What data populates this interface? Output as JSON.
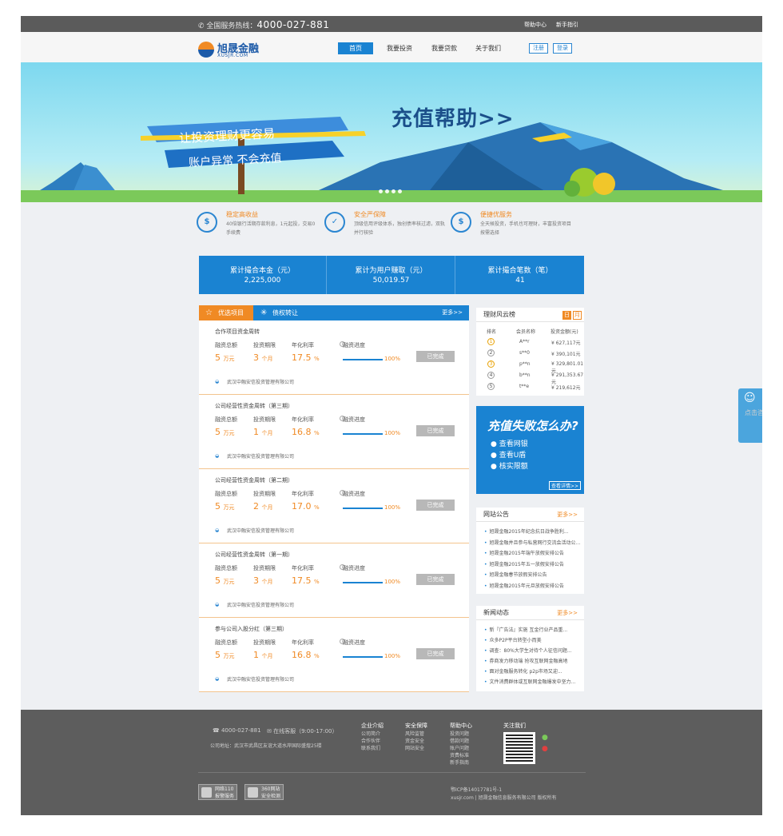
{
  "topbar": {
    "hotline_label": "全国服务热线：",
    "hotline_number": "4000-027-881",
    "help": "帮助中心",
    "guide": "新手指引"
  },
  "header": {
    "logo_name": "旭晟金融",
    "logo_url": "XUSJR.COM",
    "nav": [
      "首页",
      "我要投资",
      "我要贷款",
      "关于我们"
    ],
    "register": "注册",
    "login": "登录"
  },
  "banner": {
    "title": "充值帮助>>",
    "sign1": "让投资理财更容易",
    "sign2": "账户异常  不会充值"
  },
  "features": [
    {
      "title": "稳定高收益",
      "desc": "40倍银行活期存款利息，1元起投，交易0手续费"
    },
    {
      "title": "安全严保障",
      "desc": "顶级信用评级体系，独创债率核过滤，双轨并行核验"
    },
    {
      "title": "便捷优服务",
      "desc": "全天候投资，手机也可理财，丰富投资项目按需选择"
    }
  ],
  "stats": [
    {
      "label": "累计撮合本金（元）",
      "value": "2,225,000"
    },
    {
      "label": "累计为用户赚取（元）",
      "value": "50,019.57"
    },
    {
      "label": "累计撮合笔数（笔）",
      "value": "41"
    }
  ],
  "projects_panel": {
    "tab1": "优选项目",
    "tab2": "债权转让",
    "more": "更多>>"
  },
  "project_labels": {
    "total": "融资总额",
    "period": "投资期限",
    "rate": "年化利率",
    "progress": "融资进度",
    "done": "已完成"
  },
  "projects": [
    {
      "title": "合作项目资金周转",
      "total": "5",
      "total_unit": "万元",
      "period": "3",
      "period_unit": "个月",
      "rate": "17.5",
      "rate_unit": "%",
      "progress": "100%",
      "company": "武汉中融安信投资管理有限公司"
    },
    {
      "title": "公司经营性资金周转（第三期）",
      "total": "5",
      "total_unit": "万元",
      "period": "1",
      "period_unit": "个月",
      "rate": "16.8",
      "rate_unit": "%",
      "progress": "100%",
      "company": "武汉中融安信投资管理有限公司"
    },
    {
      "title": "公司经营性资金周转（第二期）",
      "total": "5",
      "total_unit": "万元",
      "period": "2",
      "period_unit": "个月",
      "rate": "17.0",
      "rate_unit": "%",
      "progress": "100%",
      "company": "武汉中融安信投资管理有限公司"
    },
    {
      "title": "公司经营性资金周转（第一期）",
      "total": "5",
      "total_unit": "万元",
      "period": "3",
      "period_unit": "个月",
      "rate": "17.5",
      "rate_unit": "%",
      "progress": "100%",
      "company": "武汉中融安信投资管理有限公司"
    },
    {
      "title": "参与公司入股分红（第三期）",
      "total": "5",
      "total_unit": "万元",
      "period": "1",
      "period_unit": "个月",
      "rate": "16.8",
      "rate_unit": "%",
      "progress": "100%",
      "company": "武汉中融安信投资管理有限公司"
    }
  ],
  "ranking": {
    "title": "理财风云榜",
    "tab_day": "日",
    "tab_month": "月",
    "headers": [
      "排名",
      "会员名称",
      "投资金额(元)"
    ],
    "rows": [
      {
        "rank": "1",
        "name": "A**r",
        "amount": "¥ 627,117元"
      },
      {
        "rank": "2",
        "name": "s**0",
        "amount": "¥ 390,101元"
      },
      {
        "rank": "3",
        "name": "p**n",
        "amount": "¥ 329,801.01元"
      },
      {
        "rank": "4",
        "name": "b**n",
        "amount": "¥ 291,353.67元"
      },
      {
        "rank": "5",
        "name": "t**e",
        "amount": "¥ 219,612元"
      }
    ]
  },
  "ad": {
    "title": "充值失败怎么办?",
    "items": [
      "查看网银",
      "查看U盾",
      "核实限额"
    ],
    "more": "查看详情>>"
  },
  "notice": {
    "title": "网站公告",
    "more": "更多>>",
    "items": [
      "旭晟金融2015年纪念抗日战争胜利...",
      "旭晟金融并且参与私营网行交流会活动公...",
      "旭晟金融2015年端午放假安排公告",
      "旭晟金融2015年五一放假安排公告",
      "旭晟金融春节放假安排公告",
      "旭晟金融2015年元旦放假安排公告"
    ]
  },
  "news": {
    "title": "新闻动态",
    "more": "更多>>",
    "items": [
      "新『广告法』实施 互金行业产品重...",
      "众多P2P平台转型小而美",
      "调查：80%大学生对待个人征信问题...",
      "券商发力移动端 抢攻互联网金融高地",
      "面对金融服务转化 p2p市场又迎...",
      "文件消费群体或互联网金融爆发中坚力..."
    ]
  },
  "float": {
    "label": "点击咨询"
  },
  "footer": {
    "phone": "4000-027-881",
    "service": "在线客服（9:00-17:00）",
    "address": "公司地址：武汉市武昌区友谊大道水岸国际盛煌25楼",
    "col1": {
      "title": "企业介绍",
      "links": [
        "公司简介",
        "合作伙伴",
        "联系我们"
      ]
    },
    "col2": {
      "title": "安全保障",
      "links": [
        "风险监管",
        "资金安全",
        "网站安全"
      ]
    },
    "col3": {
      "title": "帮助中心",
      "links": [
        "投资问题",
        "借款问题",
        "账户问题",
        "资费标准",
        "新手指南"
      ]
    },
    "col4": {
      "title": "关注我们"
    },
    "badge1": "网络110\n报警服务",
    "badge2": "360网站\n安全检测",
    "icp": "鄂ICP备14017781号-1",
    "copyright": "xusjr.com | 旭晟金融信息服务有限公司 版权所有"
  }
}
